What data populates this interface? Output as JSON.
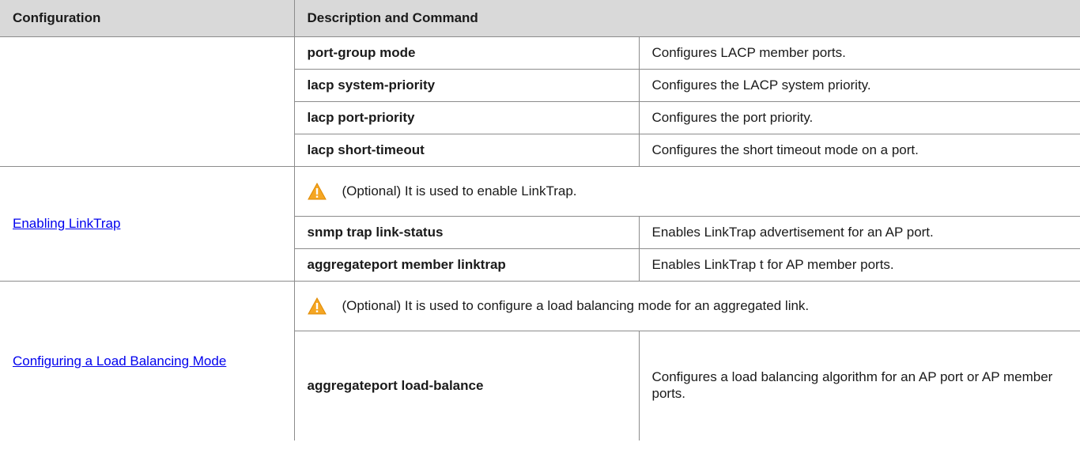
{
  "header": {
    "col1": "Configuration",
    "col2": "Description and Command"
  },
  "group1": {
    "rows": [
      {
        "command": "port-group mode",
        "description": "Configures LACP member ports."
      },
      {
        "command": "lacp system-priority",
        "description": "Configures the LACP system priority."
      },
      {
        "command": "lacp port-priority",
        "description": "Configures the port priority."
      },
      {
        "command": "lacp short-timeout",
        "description": "Configures the short timeout mode on a port."
      }
    ]
  },
  "group2": {
    "link": "Enabling LinkTrap",
    "note": "(Optional) It is used to enable LinkTrap.",
    "rows": [
      {
        "command": "snmp trap link-status",
        "description": "Enables LinkTrap advertisement for an AP port."
      },
      {
        "command": "aggregateport member linktrap",
        "description": "Enables LinkTrap t for AP member ports."
      }
    ]
  },
  "group3": {
    "link": "Configuring a Load Balancing Mode",
    "note": "(Optional) It is used to configure a load balancing mode for an aggregated link.",
    "rows": [
      {
        "command": "aggregateport load-balance",
        "description": "Configures a load balancing algorithm for an AP port or AP member ports."
      }
    ]
  },
  "icons": {
    "warning": "warning-triangle-icon"
  },
  "colors": {
    "header_bg": "#d9d9d9",
    "link": "#0000ee",
    "warning": "#f5a623"
  }
}
